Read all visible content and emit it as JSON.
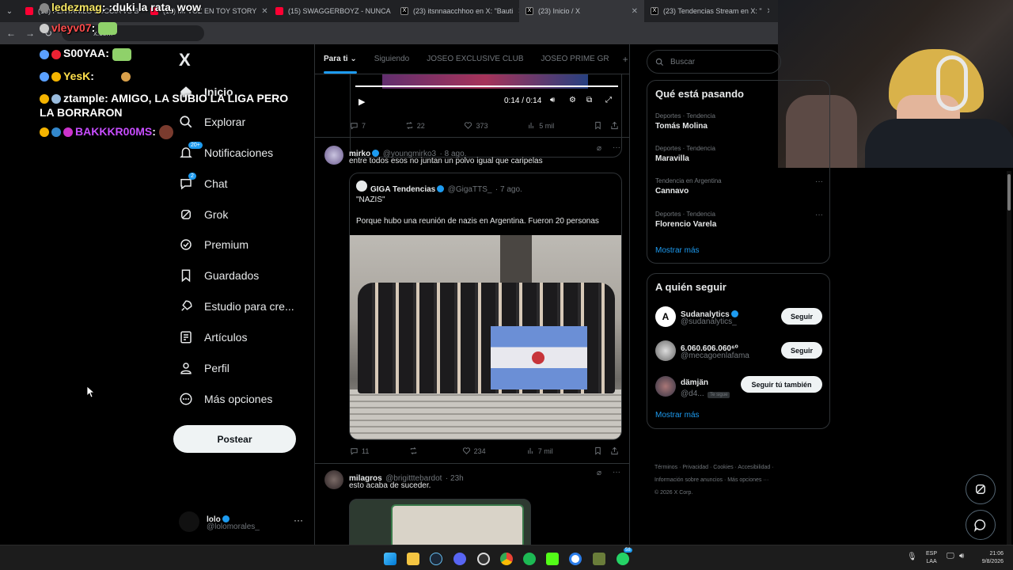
{
  "browser": {
    "tabs": [
      {
        "title": "(15) FENTANILO SUCCIA VS B",
        "type": "yt"
      },
      {
        "title": "(15) MI VOZ EN TOY STORY",
        "type": "yt"
      },
      {
        "title": "(15) SWAGGERBOYZ - NUNCA",
        "type": "yt"
      },
      {
        "title": "(23) itsnnaacchhoo en X: \"Bauti",
        "type": "x"
      },
      {
        "title": "(23) Inicio / X",
        "type": "x"
      },
      {
        "title": "(23) Tendencias Stream en X: \"",
        "type": "x"
      }
    ],
    "url": "x.com"
  },
  "chat": [
    {
      "user": "ledezmag",
      "text": ":duki la rata, wow"
    },
    {
      "user": "vleyv07",
      "text": ""
    },
    {
      "user": "S00YAA",
      "text": ""
    },
    {
      "user": "YesK",
      "text": ""
    },
    {
      "user": "ztample",
      "text": " AMIGO, LA SUBIO LA LIGA PERO LA BORRARON"
    },
    {
      "user": "BAKKKR00MS",
      "text": ""
    }
  ],
  "nav": {
    "logo": "X",
    "items": [
      {
        "label": "Inicio",
        "icon": "home-icon"
      },
      {
        "label": "Explorar",
        "icon": "search-icon"
      },
      {
        "label": "Notificaciones",
        "icon": "bell-icon",
        "badge": "20+"
      },
      {
        "label": "Chat",
        "icon": "chat-icon",
        "badge": "2"
      },
      {
        "label": "Grok",
        "icon": "grok-icon"
      },
      {
        "label": "Premium",
        "icon": "premium-icon"
      },
      {
        "label": "Guardados",
        "icon": "bookmark-icon"
      },
      {
        "label": "Estudio para cre...",
        "icon": "rocket-icon"
      },
      {
        "label": "Artículos",
        "icon": "article-icon"
      },
      {
        "label": "Perfil",
        "icon": "user-icon"
      },
      {
        "label": "Más opciones",
        "icon": "more-circle-icon"
      }
    ],
    "post_label": "Postear",
    "account": {
      "name": "lolo",
      "handle": "@lolomorales_"
    }
  },
  "timeline": {
    "tabs": [
      "Para ti",
      "Siguiendo",
      "JOSEO EXCLUSIVE CLUB",
      "JOSEO PRIME GR"
    ],
    "video": {
      "time": "0:14 / 0:14"
    },
    "tweet0_actions": {
      "replies": "7",
      "reposts": "22",
      "likes": "373",
      "views": "5 mil"
    },
    "tweet1": {
      "name": "mirko",
      "handle": "@youngmirko3",
      "time": "· 8 ago.",
      "text": "entre todos esos no juntan un polvo igual que caripelas",
      "quote": {
        "name": "GIGA Tendencias",
        "handle": "@GigaTTS_",
        "time": "· 7 ago.",
        "line1": "\"NAZIS\"",
        "line2": "Porque hubo una reunión de nazis en Argentina. Fueron 20 personas"
      },
      "actions": {
        "replies": "11",
        "reposts": "",
        "likes": "234",
        "views": "7 mil"
      }
    },
    "tweet2": {
      "name": "milagros",
      "handle": "@brigitttebardot",
      "time": "· 23h",
      "text": "esto acaba de suceder."
    }
  },
  "right": {
    "search_placeholder": "Buscar",
    "trends_title": "Qué está pasando",
    "trends": [
      {
        "category": "Deportes · Tendencia",
        "name": "Tomás Molina"
      },
      {
        "category": "Deportes · Tendencia",
        "name": "Maravilla"
      },
      {
        "category": "Tendencia en Argentina",
        "name": "Cannavo"
      },
      {
        "category": "Deportes · Tendencia",
        "name": "Florencio Varela"
      }
    ],
    "show_more": "Mostrar más",
    "follow_title": "A quién seguir",
    "follow": [
      {
        "name": "Sudanalytics",
        "handle": "@sudanalytics_",
        "button": "Seguir",
        "follows_you": ""
      },
      {
        "name": "6.060.606.060⁶⁰",
        "handle": "@mecagoenlafama",
        "button": "Seguir",
        "follows_you": ""
      },
      {
        "name": "dämjän",
        "handle": "@d4...",
        "button": "Seguir tú también",
        "follows_you": "Te sigue"
      }
    ],
    "footer": {
      "line1": "Términos · Privacidad · Cookies · Accesibilidad ·",
      "line2": "Información sobre anuncios · Más opciones ···",
      "line3": "© 2026 X Corp."
    }
  },
  "taskbar": {
    "lang": "ESP",
    "lang2": "LAA",
    "time": "21:06",
    "date": "9/8/2026",
    "whatsapp_badge": "58"
  },
  "colors": {
    "accent": "#1d9bf0",
    "bg": "#000000",
    "border": "#2f3336",
    "muted": "#71767b"
  }
}
